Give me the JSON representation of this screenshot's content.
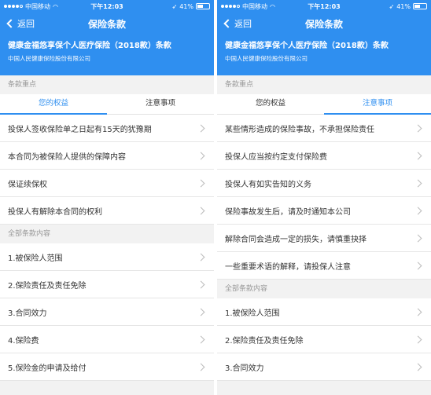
{
  "status": {
    "carrier": "中国移动",
    "time": "下午12:03",
    "battery": "41%"
  },
  "nav": {
    "back_label": "返回",
    "title": "保险条款"
  },
  "header": {
    "product_name": "健康金福悠享保个人医疗保险（2018款）条款",
    "company": "中国人民健康保险股份有限公司"
  },
  "left": {
    "key_points_label": "条款重点",
    "tabs": [
      {
        "label": "您的权益",
        "active": true
      },
      {
        "label": "注意事项",
        "active": false
      }
    ],
    "key_items": [
      "投保人签收保险单之日起有15天的犹豫期",
      "本合同为被保险人提供的保障内容",
      "保证续保权",
      "投保人有解除本合同的权利"
    ],
    "all_label": "全部条款内容",
    "all_items": [
      "1.被保险人范围",
      "2.保险责任及责任免除",
      "3.合同效力",
      "4.保险费",
      "5.保险金的申请及给付"
    ]
  },
  "right": {
    "key_points_label": "条款重点",
    "tabs": [
      {
        "label": "您的权益",
        "active": false
      },
      {
        "label": "注意事项",
        "active": true
      }
    ],
    "key_items": [
      "某些情形造成的保险事故，不承担保险责任",
      "投保人应当按约定支付保险费",
      "投保人有如实告知的义务",
      "保险事故发生后，请及时通知本公司",
      "解除合同会造成一定的损失，请慎重抉择",
      "一些重要术语的解释，请投保人注意"
    ],
    "all_label": "全部条款内容",
    "all_items": [
      "1.被保险人范围",
      "2.保险责任及责任免除",
      "3.合同效力"
    ]
  },
  "colors": {
    "primary": "#2f8ff0",
    "background": "#f2f2f2"
  }
}
